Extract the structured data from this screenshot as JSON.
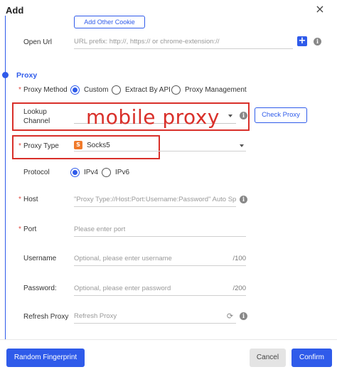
{
  "dialog": {
    "title": "Add"
  },
  "cookie": {
    "add_other_label": "Add Other Cookie",
    "open_url_label": "Open Url",
    "open_url_placeholder": "URL prefix: http://, https:// or chrome-extension://",
    "plus_icon": "plus-icon"
  },
  "proxy": {
    "section_title": "Proxy",
    "method_label": "Proxy Method",
    "method_options": [
      "Custom",
      "Extract By API",
      "Proxy Management"
    ],
    "method_selected": "Custom",
    "lookup_channel_label_line1": "Lookup",
    "lookup_channel_label_line2": "Channel",
    "lookup_channel_value": "mobile proxy",
    "check_proxy_label": "Check Proxy",
    "type_label": "Proxy Type",
    "type_icon_letter": "S",
    "type_value": "Socks5",
    "protocol_label": "Protocol",
    "protocol_options": [
      "IPv4",
      "IPv6"
    ],
    "protocol_selected": "IPv4",
    "host_label": "Host",
    "host_placeholder": "\"Proxy Type://Host:Port:Username:Password\" Auto Sp",
    "port_label": "Port",
    "port_placeholder": "Please enter port",
    "username_label": "Username",
    "username_placeholder": "Optional, please enter username",
    "username_counter": "/100",
    "password_label": "Password:",
    "password_placeholder": "Optional, please enter password",
    "password_counter": "/200",
    "refresh_label": "Refresh Proxy",
    "refresh_placeholder": "Refresh Proxy"
  },
  "footer": {
    "random_fingerprint_label": "Random Fingerprint",
    "cancel_label": "Cancel",
    "confirm_label": "Confirm"
  },
  "colors": {
    "accent": "#2f5bea",
    "highlight_red": "#d9302a",
    "socks_orange": "#f07a2b"
  },
  "info_icon_glyph": "i",
  "close_glyph": "×",
  "plus_glyph": "+",
  "refresh_glyph": "⟳"
}
